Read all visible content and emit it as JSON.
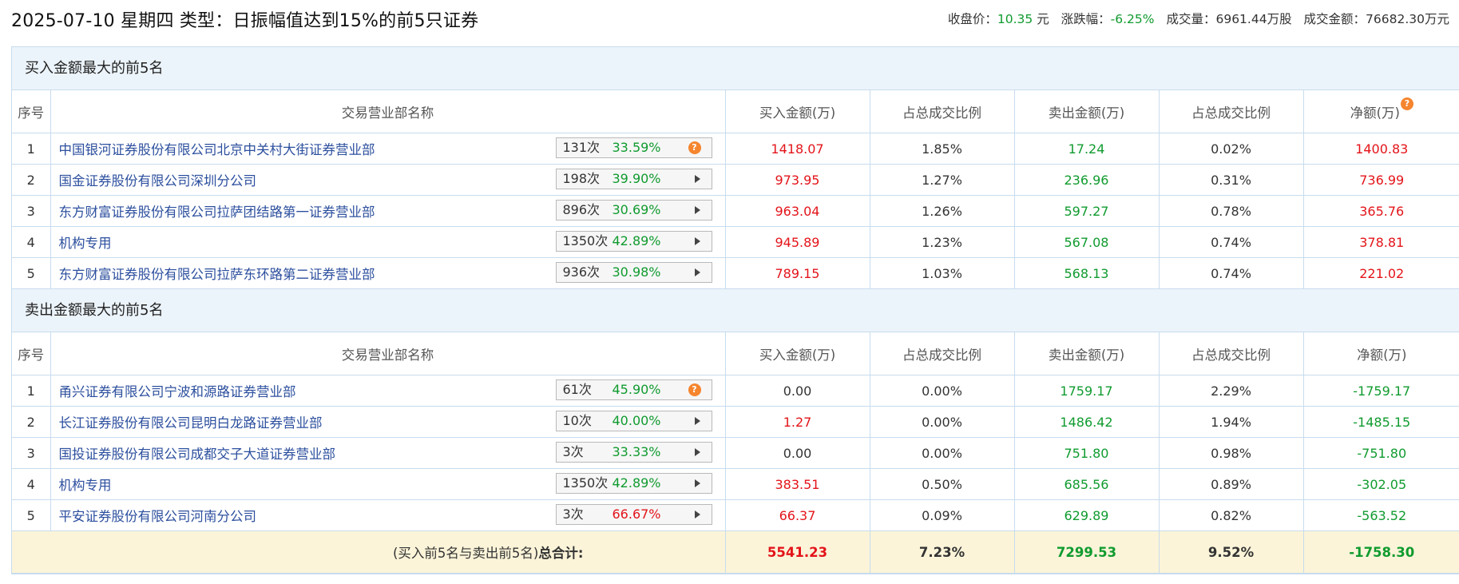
{
  "header": {
    "title": "2025-07-10 星期四 类型：日振幅值达到15%的前5只证券",
    "summary": [
      {
        "label": "收盘价：",
        "value": "10.35",
        "unit": "元"
      },
      {
        "label": "涨跌幅：",
        "value": "-6.25%",
        "unit": ""
      },
      {
        "label": "成交量：",
        "value": "6961.44万股",
        "unit": ""
      },
      {
        "label": "成交金额：",
        "value": "76682.30万元",
        "unit": ""
      }
    ]
  },
  "columns": {
    "seq": "序号",
    "name": "交易营业部名称",
    "buy": "买入金额(万)",
    "buy_pct": "占总成交比例",
    "sell": "卖出金额(万)",
    "sell_pct": "占总成交比例",
    "net": "净额(万)"
  },
  "buy_section": {
    "title": "买入金额最大的前5名",
    "rows": [
      {
        "seq": "1",
        "name": "中国银河证券股份有限公司北京中关村大街证券营业部",
        "count": "131次",
        "rate": "33.59%",
        "rate_color": "green",
        "badge_icon": "question",
        "buy": "1418.07",
        "buy_pct": "1.85%",
        "sell": "17.24",
        "sell_pct": "0.02%",
        "net": "1400.83",
        "buy_color": "red",
        "sell_color": "green",
        "net_color": "red"
      },
      {
        "seq": "2",
        "name": "国金证券股份有限公司深圳分公司",
        "count": "198次",
        "rate": "39.90%",
        "rate_color": "green",
        "badge_icon": "arrow",
        "buy": "973.95",
        "buy_pct": "1.27%",
        "sell": "236.96",
        "sell_pct": "0.31%",
        "net": "736.99",
        "buy_color": "red",
        "sell_color": "green",
        "net_color": "red"
      },
      {
        "seq": "3",
        "name": "东方财富证券股份有限公司拉萨团结路第一证券营业部",
        "count": "896次",
        "rate": "30.69%",
        "rate_color": "green",
        "badge_icon": "arrow",
        "buy": "963.04",
        "buy_pct": "1.26%",
        "sell": "597.27",
        "sell_pct": "0.78%",
        "net": "365.76",
        "buy_color": "red",
        "sell_color": "green",
        "net_color": "red"
      },
      {
        "seq": "4",
        "name": "机构专用",
        "count": "1350次",
        "rate": "42.89%",
        "rate_color": "green",
        "badge_icon": "arrow",
        "buy": "945.89",
        "buy_pct": "1.23%",
        "sell": "567.08",
        "sell_pct": "0.74%",
        "net": "378.81",
        "buy_color": "red",
        "sell_color": "green",
        "net_color": "red"
      },
      {
        "seq": "5",
        "name": "东方财富证券股份有限公司拉萨东环路第二证券营业部",
        "count": "936次",
        "rate": "30.98%",
        "rate_color": "green",
        "badge_icon": "arrow",
        "buy": "789.15",
        "buy_pct": "1.03%",
        "sell": "568.13",
        "sell_pct": "0.74%",
        "net": "221.02",
        "buy_color": "red",
        "sell_color": "green",
        "net_color": "red"
      }
    ]
  },
  "sell_section": {
    "title": "卖出金额最大的前5名",
    "rows": [
      {
        "seq": "1",
        "name": "甬兴证券有限公司宁波和源路证券营业部",
        "count": "61次",
        "rate": "45.90%",
        "rate_color": "green",
        "badge_icon": "question",
        "buy": "0.00",
        "buy_pct": "0.00%",
        "sell": "1759.17",
        "sell_pct": "2.29%",
        "net": "-1759.17",
        "buy_color": "neutral",
        "sell_color": "green",
        "net_color": "green"
      },
      {
        "seq": "2",
        "name": "长江证券股份有限公司昆明白龙路证券营业部",
        "count": "10次",
        "rate": "40.00%",
        "rate_color": "green",
        "badge_icon": "arrow",
        "buy": "1.27",
        "buy_pct": "0.00%",
        "sell": "1486.42",
        "sell_pct": "1.94%",
        "net": "-1485.15",
        "buy_color": "red",
        "sell_color": "green",
        "net_color": "green"
      },
      {
        "seq": "3",
        "name": "国投证券股份有限公司成都交子大道证券营业部",
        "count": "3次",
        "rate": "33.33%",
        "rate_color": "green",
        "badge_icon": "arrow",
        "buy": "0.00",
        "buy_pct": "0.00%",
        "sell": "751.80",
        "sell_pct": "0.98%",
        "net": "-751.80",
        "buy_color": "neutral",
        "sell_color": "green",
        "net_color": "green"
      },
      {
        "seq": "4",
        "name": "机构专用",
        "count": "1350次",
        "rate": "42.89%",
        "rate_color": "green",
        "badge_icon": "arrow",
        "buy": "383.51",
        "buy_pct": "0.50%",
        "sell": "685.56",
        "sell_pct": "0.89%",
        "net": "-302.05",
        "buy_color": "red",
        "sell_color": "green",
        "net_color": "green"
      },
      {
        "seq": "5",
        "name": "平安证券股份有限公司河南分公司",
        "count": "3次",
        "rate": "66.67%",
        "rate_color": "red",
        "badge_icon": "arrow",
        "buy": "66.37",
        "buy_pct": "0.09%",
        "sell": "629.89",
        "sell_pct": "0.82%",
        "net": "-563.52",
        "buy_color": "red",
        "sell_color": "green",
        "net_color": "green"
      }
    ]
  },
  "total": {
    "label_prefix": "(买入前5名与卖出前5名)",
    "label_bold": "总合计:",
    "buy": "5541.23",
    "buy_pct": "7.23%",
    "sell": "7299.53",
    "sell_pct": "9.52%",
    "net": "-1758.30"
  },
  "colors": {
    "red": "#e3141a",
    "green": "#109b2f",
    "neutral": "#333333",
    "link": "#2c4f9e",
    "accent_header": "#ecf4fb",
    "total_bg": "#fbf4d9"
  },
  "icons": {
    "help": "question-icon",
    "expand": "arrow-right-icon"
  }
}
